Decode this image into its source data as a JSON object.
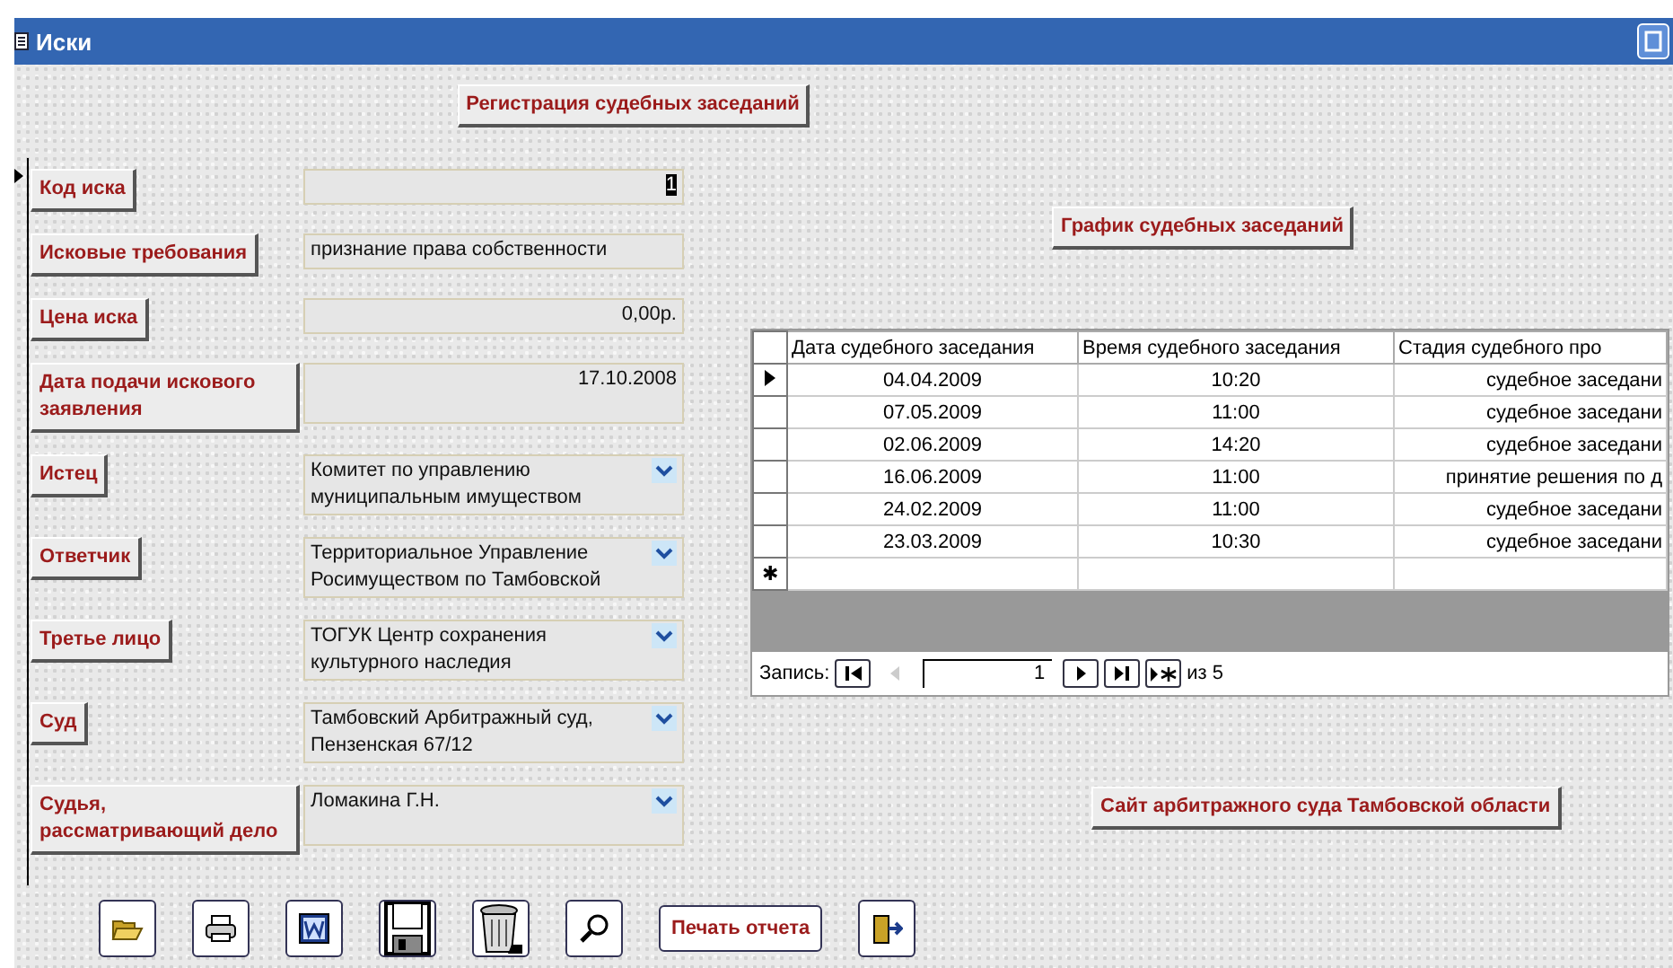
{
  "window": {
    "title": "Иски"
  },
  "header_button": "Регистрация судебных заседаний",
  "fields": [
    {
      "label": "Код иска",
      "value": "1",
      "kind": "number",
      "focused": true
    },
    {
      "label": "Исковые требования",
      "value": "признание права собственности",
      "kind": "text",
      "focused": false
    },
    {
      "label": "Цена иска",
      "value": "0,00р.",
      "kind": "number",
      "focused": false
    },
    {
      "label": "Дата подачи искового заявления",
      "value": "17.10.2008",
      "kind": "number",
      "focused": false
    },
    {
      "label": "Истец",
      "value": "Комитет по управлению муниципальным имуществом",
      "kind": "combo",
      "focused": false
    },
    {
      "label": "Ответчик",
      "value": "Территориальное Управление Росимуществом по Тамбовской",
      "kind": "combo",
      "focused": false
    },
    {
      "label": "Третье лицо",
      "value": "ТОГУК Центр сохранения культурного наследия",
      "kind": "combo",
      "focused": false
    },
    {
      "label": "Суд",
      "value": "Тамбовский Арбитражный суд, Пензенская 67/12",
      "kind": "combo",
      "focused": false
    },
    {
      "label": "Судья, рассматривающий дело",
      "value": "Ломакина Г.Н.",
      "kind": "combo",
      "focused": false
    }
  ],
  "schedule_button": "График судебных заседаний",
  "table": {
    "columns": [
      "Дата судебного заседания",
      "Время судебного заседания",
      "Стадия судебного про"
    ],
    "rows": [
      {
        "cells": [
          "04.04.2009",
          "10:20",
          "судебное заседани"
        ],
        "current": true
      },
      {
        "cells": [
          "07.05.2009",
          "11:00",
          "судебное заседани"
        ],
        "current": false
      },
      {
        "cells": [
          "02.06.2009",
          "14:20",
          "судебное заседани"
        ],
        "current": false
      },
      {
        "cells": [
          "16.06.2009",
          "11:00",
          "принятие решения по д"
        ],
        "current": false
      },
      {
        "cells": [
          "24.02.2009",
          "11:00",
          "судебное заседани"
        ],
        "current": false
      },
      {
        "cells": [
          "23.03.2009",
          "10:30",
          "судебное заседани"
        ],
        "current": false
      }
    ],
    "new_row_marker": "✱"
  },
  "navigator": {
    "label": "Запись:",
    "current": "1",
    "total": "из 5"
  },
  "site_button": "Сайт арбитражного суда Тамбовской области",
  "toolbar": [
    {
      "kind": "open"
    },
    {
      "kind": "print"
    },
    {
      "kind": "word"
    },
    {
      "kind": "save"
    },
    {
      "kind": "delete"
    },
    {
      "kind": "find"
    },
    {
      "kind": "text",
      "label": "Печать отчета"
    },
    {
      "kind": "exit"
    }
  ]
}
